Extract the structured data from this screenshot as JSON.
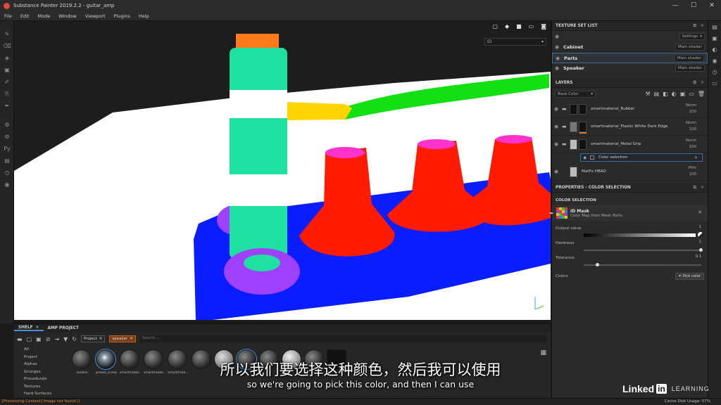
{
  "window": {
    "title": "Substance Painter 2019.2.2 - guitar_amp",
    "controls": [
      "—",
      "☐",
      "✕"
    ]
  },
  "menu": [
    "File",
    "Edit",
    "Mode",
    "Window",
    "Viewport",
    "Plugins",
    "Help"
  ],
  "viewport": {
    "channel_select": "ID",
    "colors": {
      "background": "#1d1d1d",
      "floor": "#ffffff",
      "base": "#0a1dff",
      "knobs": "#ff1a00",
      "knob_tops": "#ff33cc",
      "rings": "#a040ff",
      "jack_green": "#1ee0a0",
      "jack_white": "#ffffff",
      "jack_top": "#ff7a1a",
      "plug_yellow": "#ffd400",
      "cable": "#13e013"
    }
  },
  "texture_set_list": {
    "title": "TEXTURE SET LIST",
    "settings_label": "Settings",
    "sets": [
      {
        "name": "Cabinet",
        "shader": "Main shader"
      },
      {
        "name": "Parts",
        "shader": "Main shader",
        "selected": true
      },
      {
        "name": "Speaker",
        "shader": "Main shader"
      }
    ]
  },
  "layers": {
    "title": "LAYERS",
    "channel": "Base Color",
    "items": [
      {
        "name": "smartmaterial_Rubber",
        "blend": "Norm",
        "opacity": "100"
      },
      {
        "name": "smartmaterial_Plastic White Dark Edge",
        "blend": "Norm",
        "opacity": "100"
      },
      {
        "name": "smartmaterial_Metal Grip",
        "blend": "Norm",
        "opacity": "100"
      }
    ],
    "effect": {
      "name": "Color selection"
    },
    "last": {
      "name": "MatFx HBAO",
      "blend": "Pthr",
      "opacity": "100"
    }
  },
  "properties": {
    "title": "PROPERTIES - COLOR SELECTION",
    "section": "COLOR SELECTION",
    "idmask": {
      "title": "ID Mask",
      "subtitle": "Color Map from Mesh Parts"
    },
    "output_value": {
      "label": "Output value",
      "value": "1"
    },
    "hardness": {
      "label": "Hardness",
      "value": "1"
    },
    "tolerance": {
      "label": "Tolerance",
      "value": "0.1"
    },
    "colors_label": "Colors",
    "pick_color_label": "Pick color"
  },
  "shelf": {
    "tabs": [
      "SHELF",
      "AMP PROJECT"
    ],
    "filters": [
      "Project",
      "speaker"
    ],
    "search_placeholder": "Search...",
    "categories": [
      "All",
      "Project",
      "Alphas",
      "Grunges",
      "Procedurals",
      "Textures",
      "Hard Surfaces"
    ],
    "items": [
      "leather",
      "preset_screw",
      "smartmateri...",
      "smartmateri...",
      "smartmate..."
    ]
  },
  "subtitles": {
    "cn": "所以我们要选择这种颜色，然后我可以使用",
    "en": "so we're going to pick this color, and then I can use"
  },
  "branding": {
    "word": "Linked",
    "box": "in",
    "learning": "LEARNING"
  },
  "status": {
    "left": "[Processing Context] Image not found ()",
    "right": "Cache Disk Usage:    57%"
  }
}
